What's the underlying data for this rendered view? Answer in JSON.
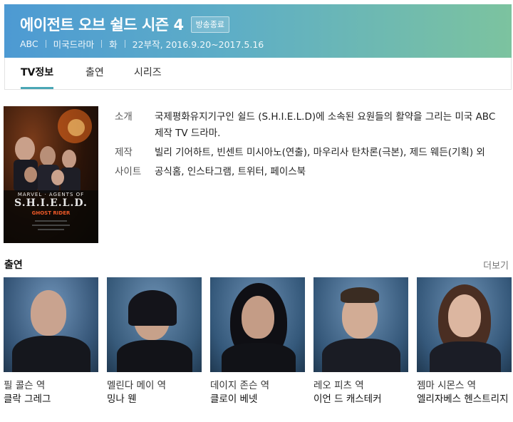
{
  "header": {
    "title": "에이전트 오브 쉴드 시즌 4",
    "status_badge": "방송종료",
    "meta": [
      "ABC",
      "미국드라마",
      "화",
      "22부작, 2016.9.20~2017.5.16"
    ]
  },
  "tabs": [
    {
      "label": "TV정보",
      "active": true
    },
    {
      "label": "출연",
      "active": false
    },
    {
      "label": "시리즈",
      "active": false
    }
  ],
  "poster": {
    "small": "MARVEL · AGENTS OF",
    "logo": "S.H.I.E.L.D.",
    "sub": "GHOST RIDER"
  },
  "info": {
    "intro_label": "소개",
    "intro": "국제평화유지기구인 쉴드 (S.H.I.E.L.D)에 소속된 요원들의 활약을 그리는 미국 ABC 제작 TV 드라마.",
    "production_label": "제작",
    "production": "빌리 기어하트, 빈센트 미시아노(연출), 마우리사 탄차론(극본), 제드 웨든(기획) 외",
    "site_label": "사이트",
    "sites": [
      "공식홈",
      "인스타그램",
      "트위터",
      "페이스북"
    ]
  },
  "cast": {
    "title": "출연",
    "more": "더보기",
    "members": [
      {
        "role": "필 콜슨 역",
        "name": "클락 그레그"
      },
      {
        "role": "멜린다 메이 역",
        "name": "밍나 웬"
      },
      {
        "role": "데이지 존슨 역",
        "name": "클로이 베넷"
      },
      {
        "role": "레오 피츠 역",
        "name": "이언 드 캐스테커"
      },
      {
        "role": "젬마 시몬스 역",
        "name": "엘리자베스 헨스트리지"
      }
    ]
  },
  "colors": {
    "header_gradient_start": "#4d9ad3",
    "header_gradient_end": "#7cc39f",
    "tab_active_underline": "#4aa7b5"
  }
}
